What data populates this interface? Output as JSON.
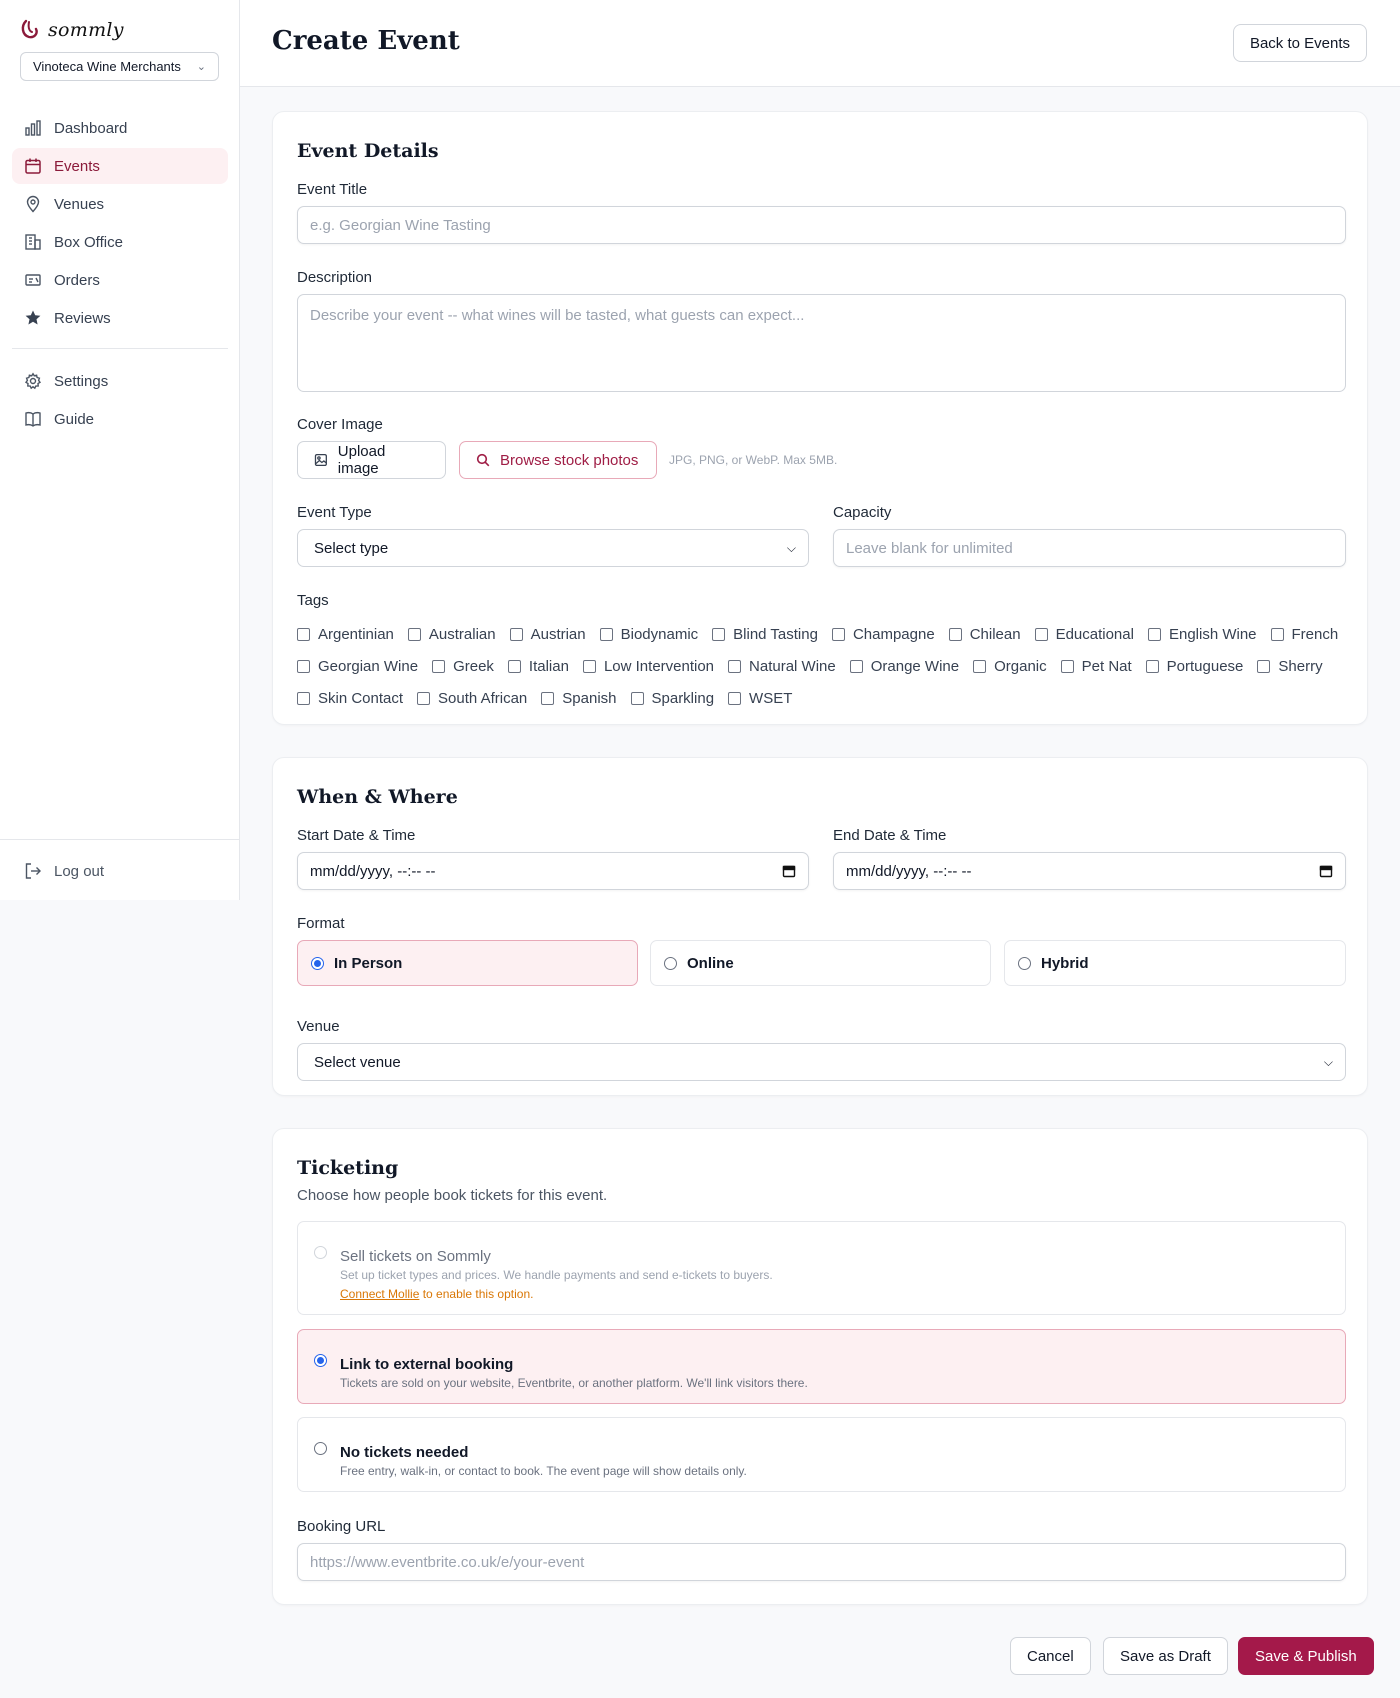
{
  "brand": {
    "name": "sommly"
  },
  "org": {
    "name": "Vinoteca Wine Merchants"
  },
  "nav": {
    "items": [
      {
        "label": "Dashboard",
        "icon": "bar-chart-icon"
      },
      {
        "label": "Events",
        "icon": "calendar-icon",
        "active": true
      },
      {
        "label": "Venues",
        "icon": "map-pin-icon"
      },
      {
        "label": "Box Office",
        "icon": "building-icon"
      },
      {
        "label": "Orders",
        "icon": "ticket-icon"
      },
      {
        "label": "Reviews",
        "icon": "star-icon"
      }
    ],
    "secondary": [
      {
        "label": "Settings",
        "icon": "gear-icon"
      },
      {
        "label": "Guide",
        "icon": "book-icon"
      }
    ],
    "logout": "Log out"
  },
  "header": {
    "title": "Create Event",
    "back_label": "Back to Events"
  },
  "details": {
    "title": "Event Details",
    "event_title_label": "Event Title",
    "event_title_placeholder": "e.g. Georgian Wine Tasting",
    "description_label": "Description",
    "description_placeholder": "Describe your event -- what wines will be tasted, what guests can expect...",
    "cover_label": "Cover Image",
    "upload_label": "Upload image",
    "stock_label": "Browse stock photos",
    "cover_hint": "JPG, PNG, or WebP. Max 5MB.",
    "type_label": "Event Type",
    "type_value": "Select type",
    "capacity_label": "Capacity",
    "capacity_placeholder": "Leave blank for unlimited",
    "tags_label": "Tags",
    "tags": [
      "Argentinian",
      "Australian",
      "Austrian",
      "Biodynamic",
      "Blind Tasting",
      "Champagne",
      "Chilean",
      "Educational",
      "English Wine",
      "French",
      "Georgian Wine",
      "Greek",
      "Italian",
      "Low Intervention",
      "Natural Wine",
      "Orange Wine",
      "Organic",
      "Pet Nat",
      "Portuguese",
      "Sherry",
      "Skin Contact",
      "South African",
      "Spanish",
      "Sparkling",
      "WSET"
    ]
  },
  "when": {
    "title": "When & Where",
    "start_label": "Start Date & Time",
    "end_label": "End Date & Time",
    "date_placeholder": "mm/dd/yyyy, --:-- --",
    "format_label": "Format",
    "formats": [
      "In Person",
      "Online",
      "Hybrid"
    ],
    "venue_label": "Venue",
    "venue_value": "Select venue"
  },
  "ticketing": {
    "title": "Ticketing",
    "subtitle": "Choose how people book tickets for this event.",
    "options": [
      {
        "title": "Sell tickets on Sommly",
        "desc": "Set up ticket types and prices. We handle payments and send e-tickets to buyers.",
        "link": "Connect Mollie",
        "link_suffix": " to enable this option."
      },
      {
        "title": "Link to external booking",
        "desc": "Tickets are sold on your website, Eventbrite, or another platform. We'll link visitors there."
      },
      {
        "title": "No tickets needed",
        "desc": "Free entry, walk-in, or contact to book. The event page will show details only."
      }
    ],
    "url_label": "Booking URL",
    "url_placeholder": "https://www.eventbrite.co.uk/e/your-event"
  },
  "footer": {
    "cancel": "Cancel",
    "draft": "Save as Draft",
    "publish": "Save & Publish"
  },
  "colors": {
    "accent": "#a4194a",
    "accent_bg": "#fdf0f2",
    "radio": "#2563eb"
  }
}
